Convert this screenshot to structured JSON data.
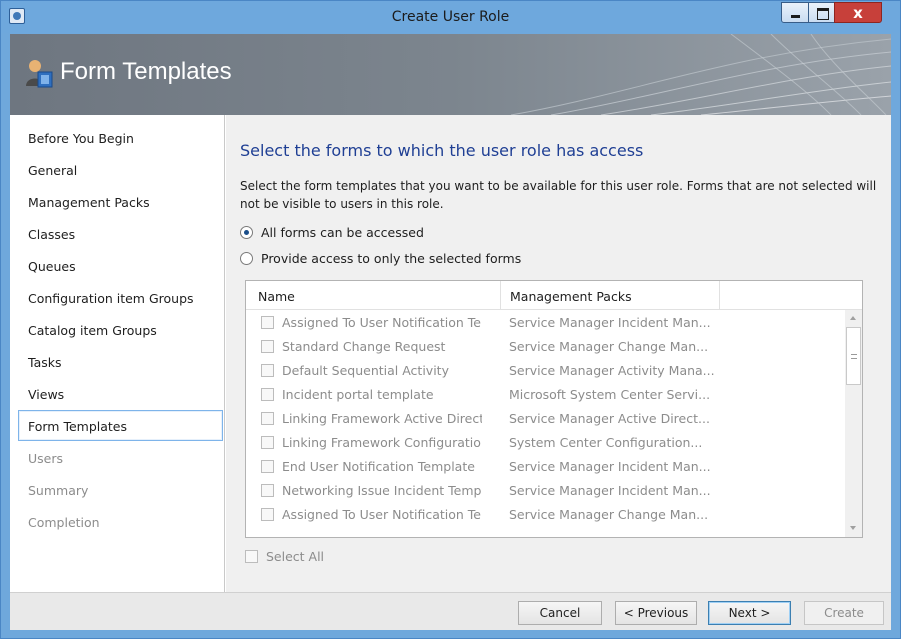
{
  "window": {
    "title": "Create User Role",
    "close_glyph": "x"
  },
  "header": {
    "title": "Form Templates",
    "icon": "user-role-icon"
  },
  "nav": {
    "items": [
      {
        "label": "Before You Begin",
        "state": "enabled"
      },
      {
        "label": "General",
        "state": "enabled"
      },
      {
        "label": "Management Packs",
        "state": "enabled"
      },
      {
        "label": "Classes",
        "state": "enabled"
      },
      {
        "label": "Queues",
        "state": "enabled"
      },
      {
        "label": "Configuration item Groups",
        "state": "enabled"
      },
      {
        "label": "Catalog item Groups",
        "state": "enabled"
      },
      {
        "label": "Tasks",
        "state": "enabled"
      },
      {
        "label": "Views",
        "state": "enabled"
      },
      {
        "label": "Form Templates",
        "state": "selected"
      },
      {
        "label": "Users",
        "state": "disabled"
      },
      {
        "label": "Summary",
        "state": "disabled"
      },
      {
        "label": "Completion",
        "state": "disabled"
      }
    ]
  },
  "main": {
    "heading": "Select the forms to which the user role has access",
    "description": "Select the form templates that you want to be available for this user role. Forms that are not selected will not be visible to users in this role.",
    "radio_all": {
      "label": "All forms can be accessed",
      "checked": true
    },
    "radio_selected": {
      "label": "Provide access to only the selected forms",
      "checked": false
    },
    "columns": [
      "Name",
      "Management Packs"
    ],
    "rows": [
      {
        "name": "Assigned To User Notification Te",
        "pack": "Service Manager Incident Man..."
      },
      {
        "name": "Standard Change Request",
        "pack": "Service Manager Change Man..."
      },
      {
        "name": "Default Sequential Activity",
        "pack": "Service Manager Activity Mana..."
      },
      {
        "name": "Incident portal template",
        "pack": "Microsoft System Center Servi..."
      },
      {
        "name": "Linking Framework Active Direct",
        "pack": "Service Manager Active Direct..."
      },
      {
        "name": "Linking Framework Configuratio",
        "pack": "System Center Configuration..."
      },
      {
        "name": "End User Notification Template",
        "pack": "Service Manager Incident Man..."
      },
      {
        "name": "Networking Issue Incident Temp",
        "pack": "Service Manager Incident Man..."
      },
      {
        "name": "Assigned To User Notification Te",
        "pack": "Service Manager Change Man..."
      }
    ],
    "select_all": "Select All"
  },
  "footer": {
    "cancel": "Cancel",
    "previous": "< Previous",
    "next": "Next >",
    "create": "Create"
  },
  "colors": {
    "titlebar": "#6ea8dd",
    "heading": "#1f3f94",
    "close_button": "#c7403a",
    "selected_border": "#7eb4ea"
  }
}
